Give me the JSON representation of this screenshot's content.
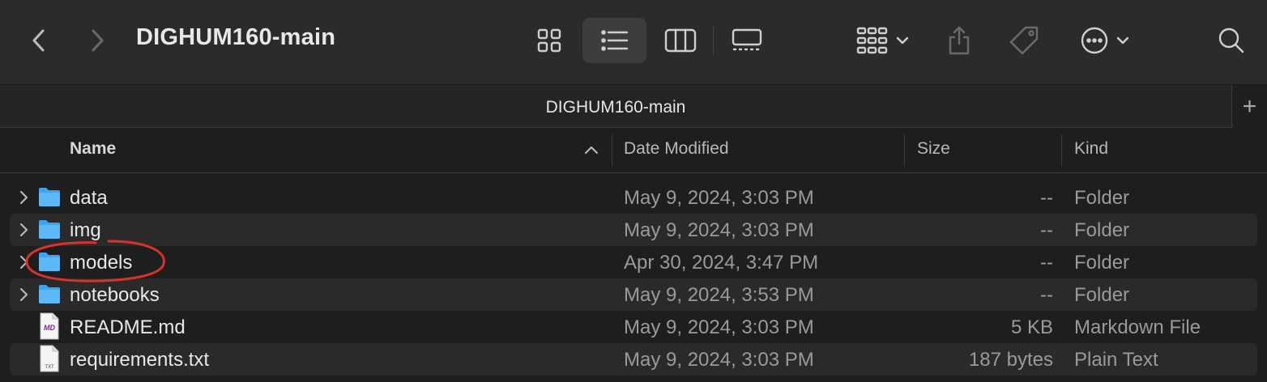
{
  "window": {
    "title": "DIGHUM160-main"
  },
  "toolbar": {
    "back_icon": "chevron-left",
    "forward_icon": "chevron-right",
    "view_icons": [
      "icon-view",
      "list-view",
      "column-view",
      "gallery-view"
    ],
    "active_view": "list-view",
    "group_icon": "group-by",
    "share_icon": "share",
    "tag_icon": "tag",
    "more_icon": "ellipsis-circle",
    "search_icon": "magnifying-glass"
  },
  "tabbar": {
    "title": "DIGHUM160-main",
    "add_label": "+"
  },
  "columns": {
    "name": "Name",
    "date": "Date Modified",
    "size": "Size",
    "kind": "Kind",
    "sort_direction": "ascending"
  },
  "rows": [
    {
      "name": "data",
      "date": "May 9, 2024, 3:03 PM",
      "size": "--",
      "kind": "Folder",
      "type": "folder",
      "highlighted": false
    },
    {
      "name": "img",
      "date": "May 9, 2024, 3:03 PM",
      "size": "--",
      "kind": "Folder",
      "type": "folder",
      "highlighted": false
    },
    {
      "name": "models",
      "date": "Apr 30, 2024, 3:47 PM",
      "size": "--",
      "kind": "Folder",
      "type": "folder",
      "highlighted": true
    },
    {
      "name": "notebooks",
      "date": "May 9, 2024, 3:53 PM",
      "size": "--",
      "kind": "Folder",
      "type": "folder",
      "highlighted": false
    },
    {
      "name": "README.md",
      "date": "May 9, 2024, 3:03 PM",
      "size": "5 KB",
      "kind": "Markdown File",
      "type": "markdown",
      "icon_label": "MD",
      "highlighted": false
    },
    {
      "name": "requirements.txt",
      "date": "May 9, 2024, 3:03 PM",
      "size": "187 bytes",
      "kind": "Plain Text",
      "type": "text",
      "icon_label": "TXT",
      "highlighted": false
    }
  ],
  "colors": {
    "toolbar_bg": "#2b2b2b",
    "window_bg": "#1e1e1e",
    "alt_row_bg": "#2a2a2a",
    "folder_blue": "#3ea4f0",
    "annotation_red": "#d9322b",
    "markdown_purple": "#7a2a8e"
  }
}
